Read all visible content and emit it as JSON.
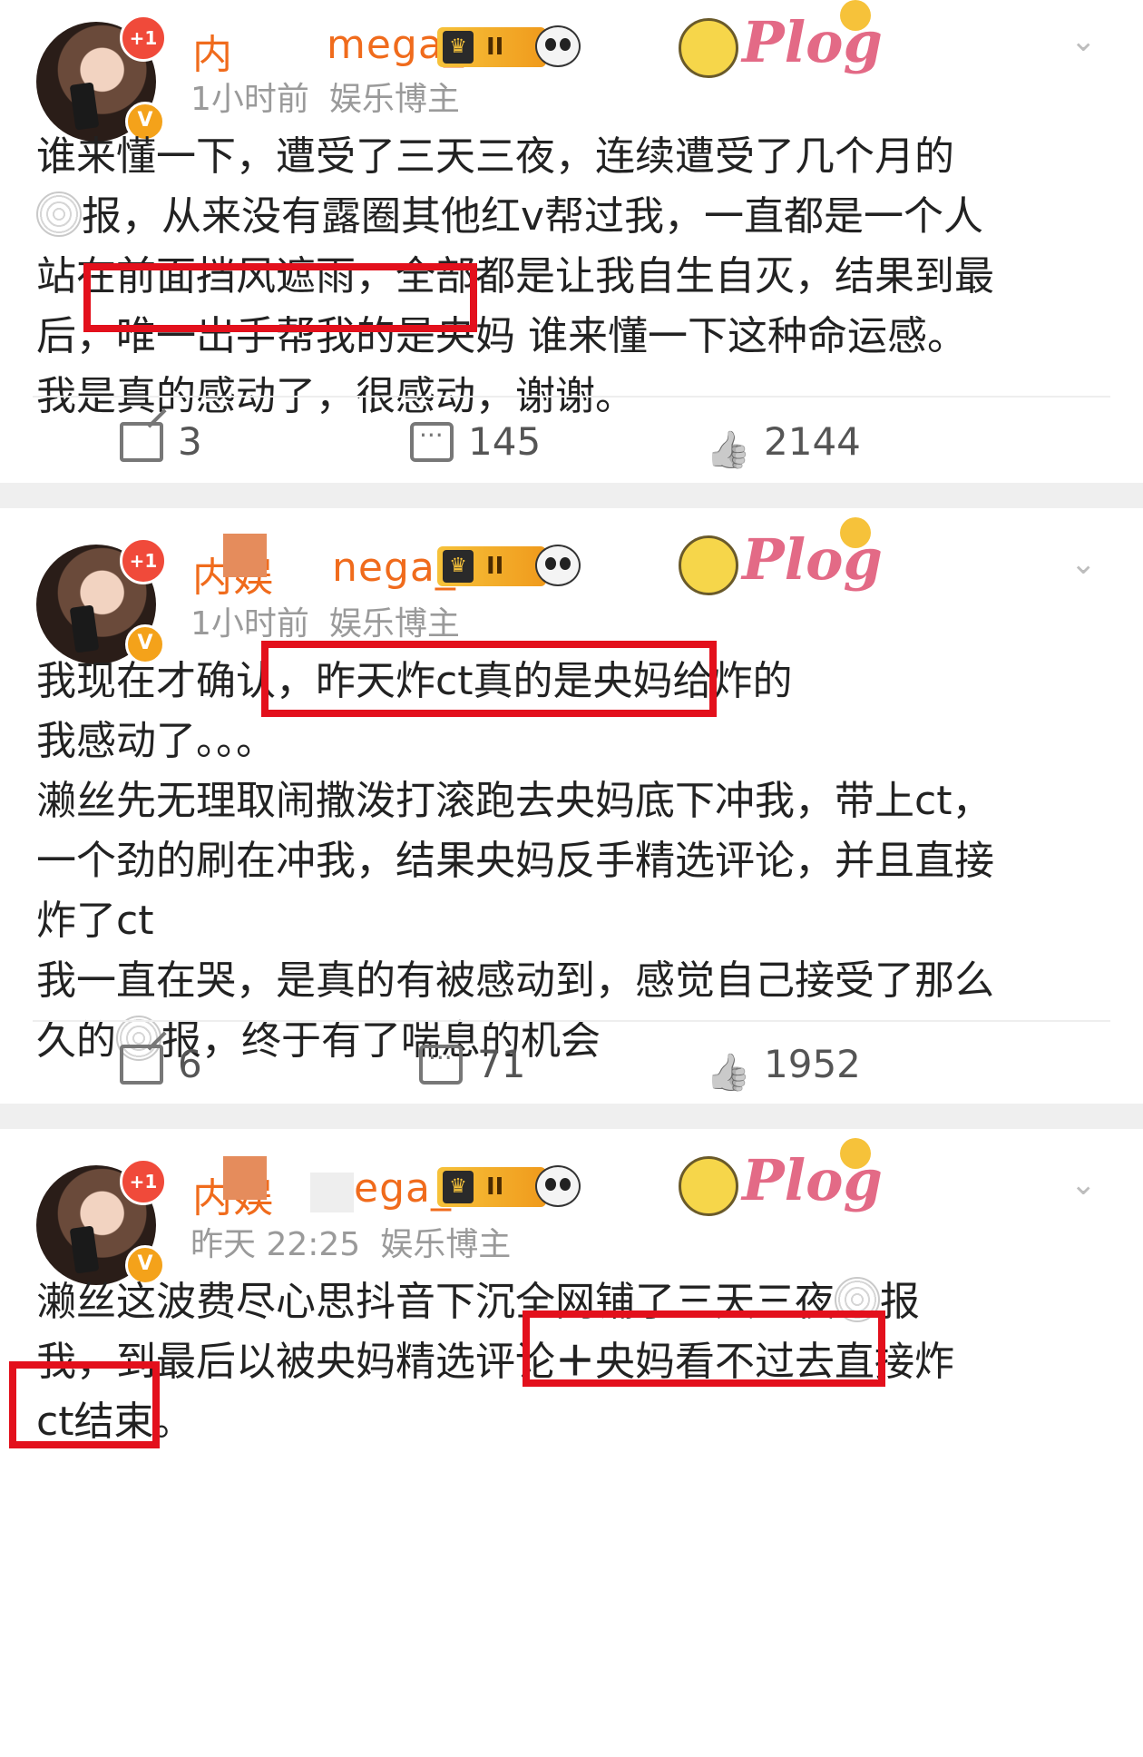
{
  "posts": [
    {
      "author": {
        "name_prefix": "内",
        "name_suffix": "mega_",
        "plus_badge": "+1",
        "verified_badge": "V",
        "vip_level": "II"
      },
      "meta": {
        "time": "1小时前",
        "tag": "娱乐博主"
      },
      "plog_label": "Plog",
      "lines": [
        "谁来懂一下，遭受了三天三夜，连续遭受了几个月的",
        "报，从来没有露圈其他红v帮过我，一直都是一个人",
        "站在前面挡风遮雨，全部都是让我自生自灭，结果到最",
        "后，唯一出手帮我的是央妈  谁来懂一下这种命运感。",
        "我是真的感动了，很感动，谢谢。"
      ],
      "highlight": "唯一出手帮我的是央妈",
      "actions": {
        "share": "3",
        "comment": "145",
        "like": "2144"
      }
    },
    {
      "author": {
        "name_prefix": "内娱",
        "name_suffix": "nega_",
        "plus_badge": "+1",
        "verified_badge": "V",
        "vip_level": "II"
      },
      "meta": {
        "time": "1小时前",
        "tag": "娱乐博主"
      },
      "plog_label": "Plog",
      "lines": [
        "我现在才确认，昨天炸ct真的是央妈给炸的",
        "我感动了。。。",
        "濑丝先无理取闹撒泼打滚跑去央妈底下冲我，带上ct，",
        "一个劲的刷在冲我，结果央妈反手精选评论，并且直接",
        "炸了ct",
        "我一直在哭，是真的有被感动到，感觉自己接受了那么",
        "报，终于有了喘息的机会"
      ],
      "line7_prefix": "久的",
      "line2_prefix": "",
      "actions": {
        "share": "6",
        "comment": "71",
        "like": "1952"
      }
    },
    {
      "author": {
        "name_prefix": "内娱",
        "name_suffix": "ega_",
        "plus_badge": "+1",
        "verified_badge": "V",
        "vip_level": "II"
      },
      "meta": {
        "time": "昨天 22:25",
        "tag": "娱乐博主"
      },
      "plog_label": "Plog",
      "lines": [
        "濑丝这波费尽心思抖音下沉全网铺了三天三夜",
        "报",
        "我，到最后以被央妈精选评论",
        "央妈看不过去直接炸",
        "ct结束。"
      ]
    }
  ]
}
